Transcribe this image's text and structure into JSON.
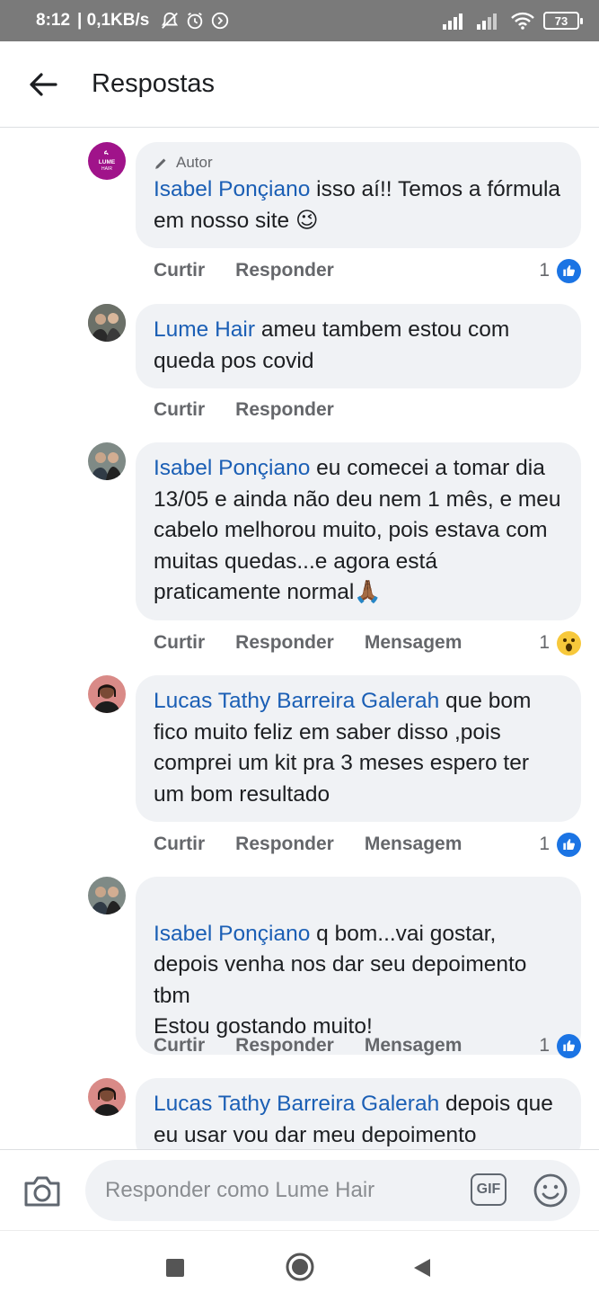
{
  "status_bar": {
    "time": "8:12",
    "speed": "| 0,1KB/s",
    "battery": "73",
    "icons": [
      "mute-notification-icon",
      "alarm-icon",
      "data-saver-icon",
      "signal-icon",
      "signal-icon",
      "wifi-icon",
      "battery-icon"
    ]
  },
  "header": {
    "title": "Respostas",
    "back_icon": "arrow-left-icon"
  },
  "comments": [
    {
      "author_badge": "Autor",
      "name": "Isabel Ponçiano",
      "text": " isso aí!! Temos a fórmula em nosso site 😉",
      "actions": [
        "Curtir",
        "Responder"
      ],
      "reaction": {
        "type": "like",
        "count": "1"
      },
      "avatar": "lume-hair-logo"
    },
    {
      "name": "Lume Hair",
      "text": " ameu tambem  estou com queda pos covid",
      "actions": [
        "Curtir",
        "Responder"
      ],
      "avatar": "user-photo"
    },
    {
      "name": "Isabel Ponçiano",
      "text": " eu comecei a tomar dia 13/05 e ainda não deu nem 1 mês, e meu cabelo melhorou muito, pois estava com muitas quedas...e agora está praticamente normal🙏🏾",
      "actions": [
        "Curtir",
        "Responder",
        "Mensagem"
      ],
      "reaction": {
        "type": "wow",
        "count": "1"
      },
      "avatar": "user-photo"
    },
    {
      "name": "Lucas Tathy Barreira Galerah",
      "text": " que bom fico muito feliz em saber disso ,pois comprei um kit pra 3 meses espero ter um bom resultado",
      "actions": [
        "Curtir",
        "Responder",
        "Mensagem"
      ],
      "reaction": {
        "type": "like",
        "count": "1"
      },
      "avatar": "user-photo"
    },
    {
      "name": "Isabel Ponçiano",
      "text": " q bom...vai gostar, depois venha nos dar seu depoimento tbm\nEstou gostando muito!",
      "actions": [
        "Curtir",
        "Responder",
        "Mensagem"
      ],
      "reaction": {
        "type": "like",
        "count": "1"
      },
      "avatar": "user-photo"
    },
    {
      "name": "Lucas Tathy Barreira Galerah",
      "text": " depois que eu usar vou dar meu depoimento",
      "actions": [],
      "avatar": "user-photo"
    }
  ],
  "logo_text": {
    "line1": "LUME",
    "line2": "HAIR"
  },
  "reply_bar": {
    "placeholder": "Responder como Lume Hair",
    "gif_label": "GIF"
  },
  "colors": {
    "link": "#1b5fb5",
    "bubble": "#f0f2f5",
    "like": "#1b74e4",
    "brand_logo": "#a0138a"
  }
}
